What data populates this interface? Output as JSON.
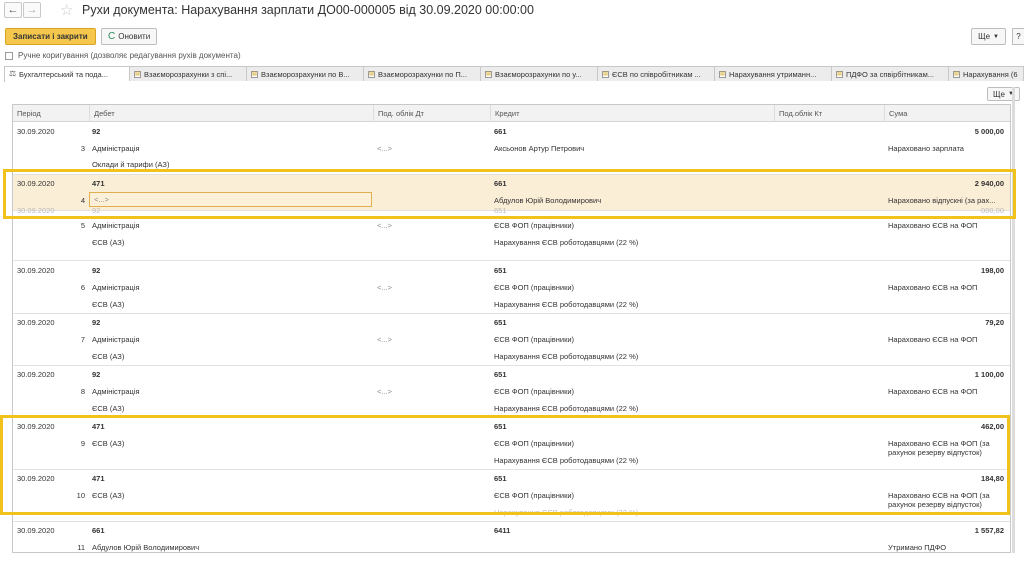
{
  "window": {
    "back_icon": "←",
    "forward_icon": "→",
    "star_icon": "☆",
    "title": "Рухи документа: Нарахування зарплати ДО00-000005 від 30.09.2020 00:00:00"
  },
  "toolbar": {
    "save_close_label": "Записати і закрити",
    "refresh_icon": "C",
    "refresh_label": "Оновити",
    "more_label": "Ще",
    "help_label": "?"
  },
  "manual_correction": {
    "label": "Ручне коригування (дозволяє редагування рухів документа)",
    "checked": false
  },
  "tabs": [
    {
      "label": "Бухгалтерський та пода...",
      "active": true
    },
    {
      "label": "Взаєморозрахунки з спі...",
      "active": false
    },
    {
      "label": "Взаєморозрахунки по В...",
      "active": false
    },
    {
      "label": "Взаєморозрахунки по П...",
      "active": false
    },
    {
      "label": "Взаєморозрахунки по у...",
      "active": false
    },
    {
      "label": "ЄСВ по співробітникам ...",
      "active": false
    },
    {
      "label": "Нарахування утриманн...",
      "active": false
    },
    {
      "label": "ПДФО за спвірбітникам...",
      "active": false
    },
    {
      "label": "Нарахування (6",
      "active": false
    }
  ],
  "grid_more_label": "Ще",
  "columns": {
    "period": "Період",
    "debit": "Дебет",
    "sub_debit": "Под. облік Дт",
    "credit": "Кредит",
    "sub_credit": "Под.облік Кт",
    "amount": "Сума"
  },
  "entries": [
    {
      "n": "3",
      "period": "30.09.2020",
      "debit": "92",
      "debit_sub1": "Адміністрація",
      "debit_sub2": "Оклади й тарифи (АЗ)",
      "sub_dt": "<...>",
      "credit": "661",
      "credit_sub1": "Аксьонов Артур Петрович",
      "credit_sub2": "",
      "amount": "5 000,00",
      "content": "Нараховано зарплата"
    },
    {
      "n": "4",
      "period": "30.09.2020",
      "debit": "471",
      "debit_sub1": "<...>",
      "debit_sub2": "",
      "sub_dt": "",
      "credit": "661",
      "credit_sub1": "Абдулов Юрій Володимирович",
      "credit_sub2": "",
      "amount": "2 940,00",
      "content": "Нараховано відпускні (за рах..."
    },
    {
      "n": "5",
      "period": "30.09.2020",
      "debit": "92",
      "debit_sub1": "Адміністрація",
      "debit_sub2": "ЄСВ (АЗ)",
      "sub_dt": "<...>",
      "credit": "651",
      "credit_sub1": "ЄСВ ФОП (працівники)",
      "credit_sub2": "Нарахування ЄСВ роботодавцями (22 %)",
      "amount": "000,00",
      "content": "Нараховано ЄСВ на ФОП"
    },
    {
      "n": "6",
      "period": "30.09.2020",
      "debit": "92",
      "debit_sub1": "Адміністрація",
      "debit_sub2": "ЄСВ (АЗ)",
      "sub_dt": "<...>",
      "credit": "651",
      "credit_sub1": "ЄСВ ФОП (працівники)",
      "credit_sub2": "Нарахування ЄСВ роботодавцями (22 %)",
      "amount": "198,00",
      "content": "Нараховано ЄСВ на ФОП"
    },
    {
      "n": "7",
      "period": "30.09.2020",
      "debit": "92",
      "debit_sub1": "Адміністрація",
      "debit_sub2": "ЄСВ (АЗ)",
      "sub_dt": "<...>",
      "credit": "651",
      "credit_sub1": "ЄСВ ФОП (працівники)",
      "credit_sub2": "Нарахування ЄСВ роботодавцями (22 %)",
      "amount": "79,20",
      "content": "Нараховано ЄСВ на ФОП"
    },
    {
      "n": "8",
      "period": "30.09.2020",
      "debit": "92",
      "debit_sub1": "Адміністрація",
      "debit_sub2": "ЄСВ (АЗ)",
      "sub_dt": "<...>",
      "credit": "651",
      "credit_sub1": "ЄСВ ФОП (працівники)",
      "credit_sub2": "Нарахування ЄСВ роботодавцями (22 %)",
      "amount": "1 100,00",
      "content": "Нараховано ЄСВ на ФОП"
    },
    {
      "n": "9",
      "period": "30.09.2020",
      "debit": "471",
      "debit_sub1": "ЄСВ (АЗ)",
      "debit_sub2": "",
      "sub_dt": "",
      "credit": "651",
      "credit_sub1": "ЄСВ ФОП (працівники)",
      "credit_sub2": "Нарахування ЄСВ роботодавцями (22 %)",
      "amount": "462,00",
      "content": "Нараховано ЄСВ на ФОП (за рахунок резерву відпусток)"
    },
    {
      "n": "10",
      "period": "30.09.2020",
      "debit": "471",
      "debit_sub1": "ЄСВ (АЗ)",
      "debit_sub2": "",
      "sub_dt": "",
      "credit": "651",
      "credit_sub1": "ЄСВ ФОП (працівники)",
      "credit_sub2": "Нарахування ЄСВ роботодавцями (22 %)",
      "amount": "184,80",
      "content": "Нараховано ЄСВ на ФОП (за рахунок резерву відпусток)"
    },
    {
      "n": "11",
      "period": "30.09.2020",
      "debit": "661",
      "debit_sub1": "Абдулов Юрій Володимирович",
      "debit_sub2": "",
      "sub_dt": "",
      "credit": "6411",
      "credit_sub1": "",
      "credit_sub2": "",
      "amount": "1 557,82",
      "content": "Утримано ПДФО"
    }
  ],
  "highlight_color": "#f1c21b",
  "selection_color": "#fbeed7"
}
